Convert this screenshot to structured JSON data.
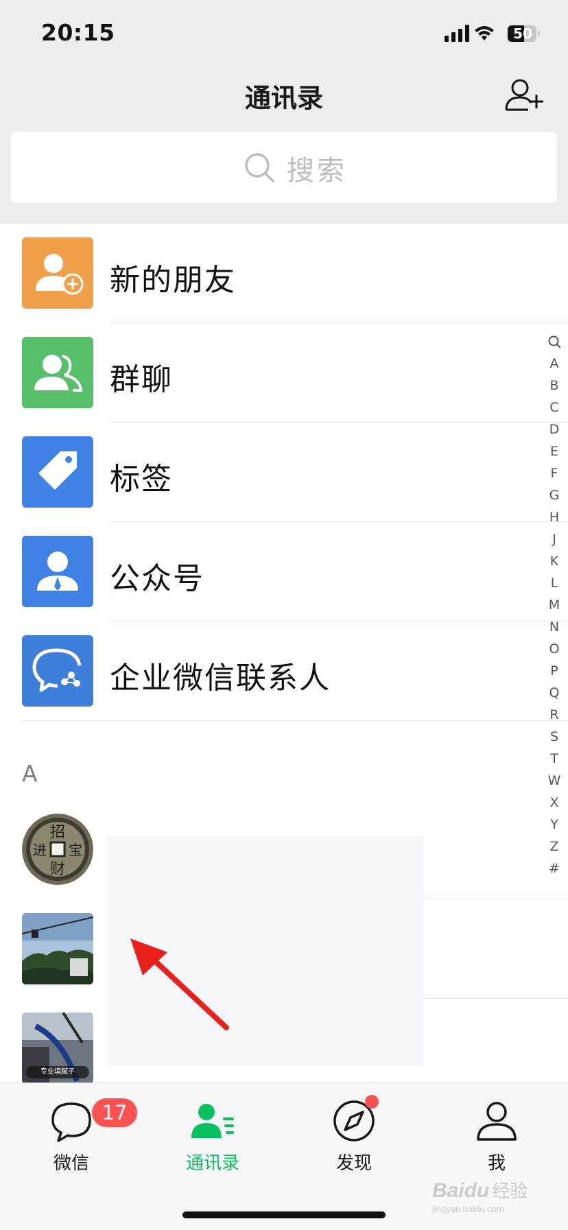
{
  "status_bar": {
    "time": "20:15",
    "battery": "50"
  },
  "nav": {
    "title": "通讯录",
    "add_friend_icon": "person-add-icon"
  },
  "search": {
    "placeholder": "搜索"
  },
  "functions": [
    {
      "label": "新的朋友",
      "icon": "new-friend-icon",
      "color": "#f0a04b"
    },
    {
      "label": "群聊",
      "icon": "group-chat-icon",
      "color": "#57be6a"
    },
    {
      "label": "标签",
      "icon": "tag-icon",
      "color": "#3f82e4"
    },
    {
      "label": "公众号",
      "icon": "official-account-icon",
      "color": "#3f82e4"
    },
    {
      "label": "企业微信联系人",
      "icon": "wecom-contacts-icon",
      "color": "#3d7fd8"
    }
  ],
  "contacts_section": {
    "letter": "A"
  },
  "index_bar": [
    "A",
    "B",
    "C",
    "D",
    "E",
    "F",
    "G",
    "H",
    "J",
    "K",
    "L",
    "M",
    "N",
    "O",
    "P",
    "Q",
    "R",
    "S",
    "T",
    "W",
    "X",
    "Y",
    "Z",
    "#"
  ],
  "avatars": {
    "third_caption": "专业填腻子"
  },
  "tabs": [
    {
      "label": "微信",
      "icon": "chat-bubble-icon",
      "badge": "17"
    },
    {
      "label": "通讯录",
      "icon": "contacts-icon",
      "active": true
    },
    {
      "label": "发现",
      "icon": "compass-icon",
      "dot": true
    },
    {
      "label": "我",
      "icon": "profile-icon"
    }
  ],
  "colors": {
    "accent": "#07c160",
    "badge": "#fa5151",
    "annotation_arrow": "#e8211c"
  },
  "watermark": {
    "brand": "Baidu",
    "brand_cn": "经验",
    "url": "jingyan.baidu.com"
  }
}
